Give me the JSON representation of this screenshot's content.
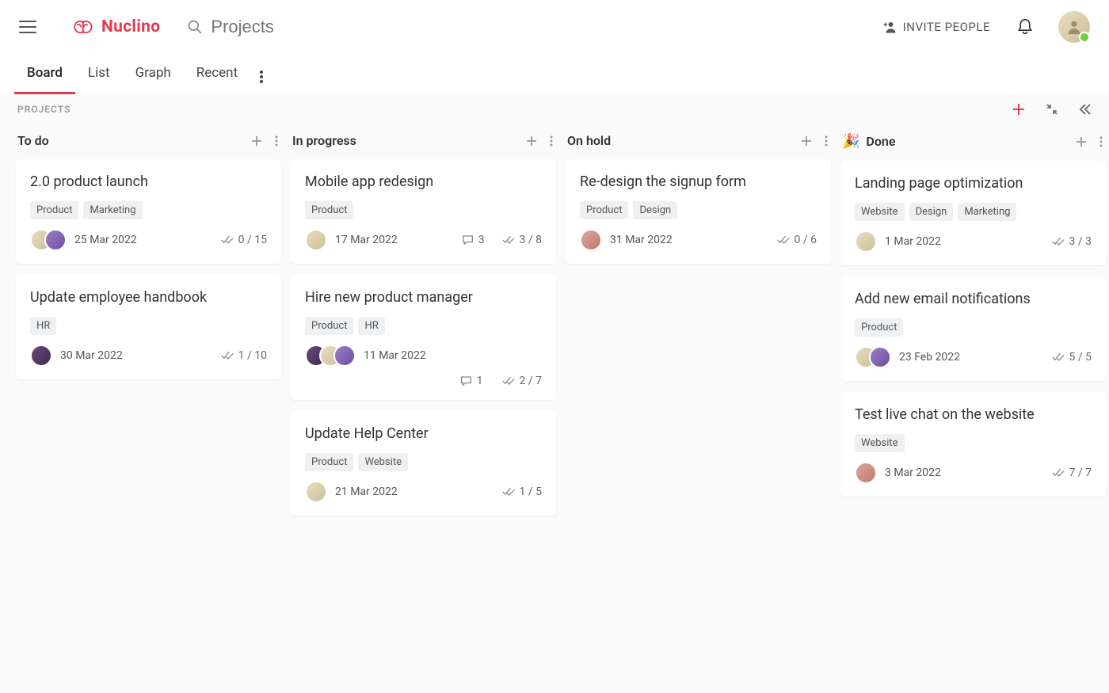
{
  "header": {
    "logo_text": "Nuclino",
    "search_placeholder": "Projects",
    "invite_label": "INVITE PEOPLE"
  },
  "tabs": {
    "items": [
      "Board",
      "List",
      "Graph",
      "Recent"
    ],
    "active_index": 0
  },
  "board": {
    "title": "PROJECTS"
  },
  "columns": [
    {
      "title": "To do",
      "emoji": "",
      "cards": [
        {
          "title": "2.0 product launch",
          "tags": [
            "Product",
            "Marketing"
          ],
          "avatars": [
            "a1",
            "a2"
          ],
          "date": "25 Mar 2022",
          "comments": null,
          "checklist": "0 / 15",
          "wrap": false
        },
        {
          "title": "Update employee handbook",
          "tags": [
            "HR"
          ],
          "avatars": [
            "a3"
          ],
          "date": "30 Mar 2022",
          "comments": null,
          "checklist": "1 / 10",
          "wrap": false
        }
      ]
    },
    {
      "title": "In progress",
      "emoji": "",
      "cards": [
        {
          "title": "Mobile app redesign",
          "tags": [
            "Product"
          ],
          "avatars": [
            "a1"
          ],
          "date": "17 Mar 2022",
          "comments": "3",
          "checklist": "3 / 8",
          "wrap": false
        },
        {
          "title": "Hire new product manager",
          "tags": [
            "Product",
            "HR"
          ],
          "avatars": [
            "a3",
            "a1",
            "a2"
          ],
          "date": "11 Mar 2022",
          "comments": "1",
          "checklist": "2 / 7",
          "wrap": true
        },
        {
          "title": "Update Help Center",
          "tags": [
            "Product",
            "Website"
          ],
          "avatars": [
            "a1"
          ],
          "date": "21 Mar 2022",
          "comments": null,
          "checklist": "1 / 5",
          "wrap": false
        }
      ]
    },
    {
      "title": "On hold",
      "emoji": "",
      "cards": [
        {
          "title": "Re-design the signup form",
          "tags": [
            "Product",
            "Design"
          ],
          "avatars": [
            "a4"
          ],
          "date": "31 Mar 2022",
          "comments": null,
          "checklist": "0 / 6",
          "wrap": false
        }
      ]
    },
    {
      "title": "Done",
      "emoji": "🎉",
      "cards": [
        {
          "title": "Landing page optimization",
          "tags": [
            "Website",
            "Design",
            "Marketing"
          ],
          "avatars": [
            "a1"
          ],
          "date": "1 Mar 2022",
          "comments": null,
          "checklist": "3 / 3",
          "wrap": false
        },
        {
          "title": "Add new email notifications",
          "tags": [
            "Product"
          ],
          "avatars": [
            "a1",
            "a2"
          ],
          "date": "23 Feb 2022",
          "comments": null,
          "checklist": "5 / 5",
          "wrap": false
        },
        {
          "title": "Test live chat on the website",
          "tags": [
            "Website"
          ],
          "avatars": [
            "a4"
          ],
          "date": "3 Mar 2022",
          "comments": null,
          "checklist": "7 / 7",
          "wrap": false
        }
      ]
    }
  ]
}
